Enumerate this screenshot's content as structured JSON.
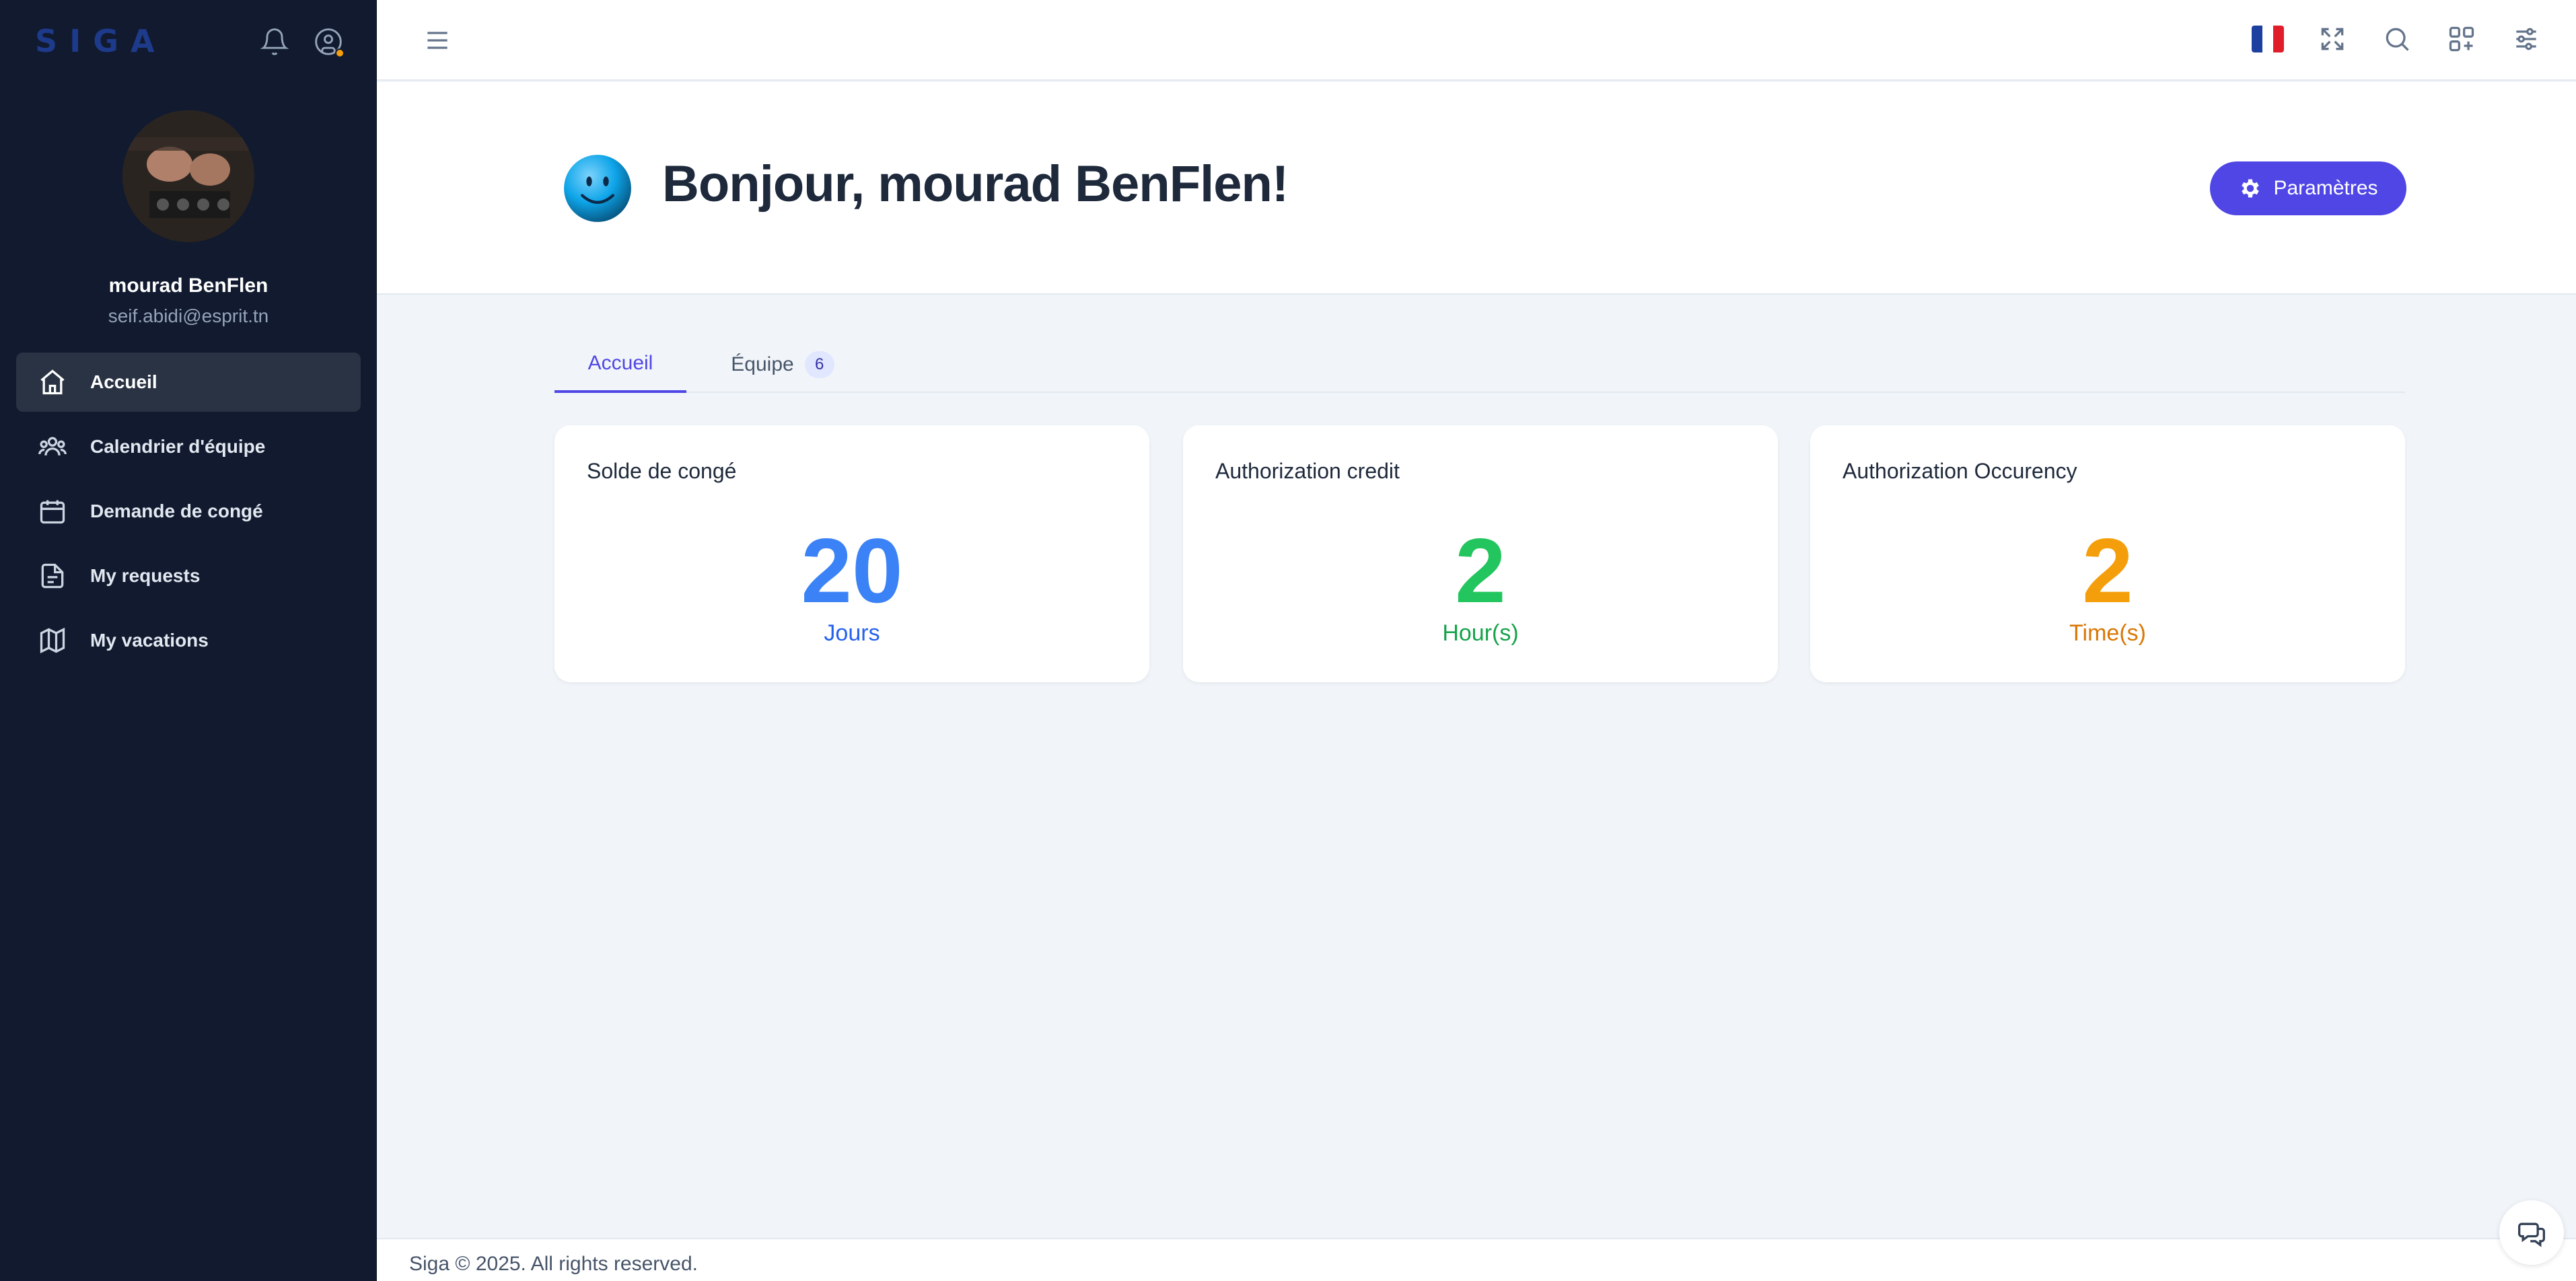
{
  "sidebar": {
    "logo": "SIGA",
    "user": {
      "name": "mourad BenFlen",
      "email": "seif.abidi@esprit.tn"
    },
    "items": [
      {
        "label": "Accueil",
        "icon": "home-icon",
        "active": true
      },
      {
        "label": "Calendrier d'équipe",
        "icon": "users-icon",
        "active": false
      },
      {
        "label": "Demande de congé",
        "icon": "calendar-icon",
        "active": false
      },
      {
        "label": "My requests",
        "icon": "file-text-icon",
        "active": false
      },
      {
        "label": "My vacations",
        "icon": "map-icon",
        "active": false
      }
    ]
  },
  "topbar": {
    "language": "fr",
    "icons": [
      "menu-icon",
      "flag-fr-icon",
      "fullscreen-icon",
      "search-icon",
      "apps-icon",
      "settings-sliders-icon"
    ]
  },
  "hero": {
    "greeting": "Bonjour, mourad BenFlen!",
    "params_label": "Paramètres"
  },
  "tabs": [
    {
      "label": "Accueil",
      "active": true
    },
    {
      "label": "Équipe",
      "count": "6",
      "active": false
    }
  ],
  "cards": [
    {
      "title": "Solde de congé",
      "value": "20",
      "unit": "Jours",
      "value_color": "#3b82f6",
      "unit_color": "#2563eb"
    },
    {
      "title": "Authorization credit",
      "value": "2",
      "unit": "Hour(s)",
      "value_color": "#22c55e",
      "unit_color": "#16a34a"
    },
    {
      "title": "Authorization Occurency",
      "value": "2",
      "unit": "Time(s)",
      "value_color": "#f59e0b",
      "unit_color": "#d97706"
    }
  ],
  "footer": {
    "text": "Siga © 2025. All rights reserved."
  },
  "colors": {
    "sidebar_bg": "#111a2f",
    "accent": "#4f46e5",
    "page_bg": "#f1f5f9"
  }
}
